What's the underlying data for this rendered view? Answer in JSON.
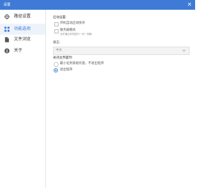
{
  "window": {
    "title": "设置",
    "close_glyph": "✕",
    "accent_color": "#3f7bd6"
  },
  "sidebar": {
    "items": [
      {
        "label": "路径设置",
        "icon": "gear-icon",
        "active": false
      },
      {
        "label": "功能选项",
        "icon": "grid-icon",
        "active": true
      },
      {
        "label": "文件浏览",
        "icon": "document-icon",
        "active": false
      },
      {
        "label": "关于",
        "icon": "info-icon",
        "active": false
      }
    ]
  },
  "settings": {
    "startup": {
      "label": "启动设置:",
      "options": [
        {
          "label": "开机自动启动快牙",
          "description": "",
          "checked": false
        },
        {
          "label": "服务器模式",
          "description": "允许通过本机进行一对一传输",
          "checked": false
        }
      ]
    },
    "language": {
      "label": "语言:",
      "selected": "中文"
    },
    "close_behavior": {
      "label": "关闭主界面时:",
      "options": [
        {
          "label": "最小化到系统托盘，不退出程序",
          "checked": false
        },
        {
          "label": "退出程序",
          "checked": true
        }
      ]
    }
  }
}
